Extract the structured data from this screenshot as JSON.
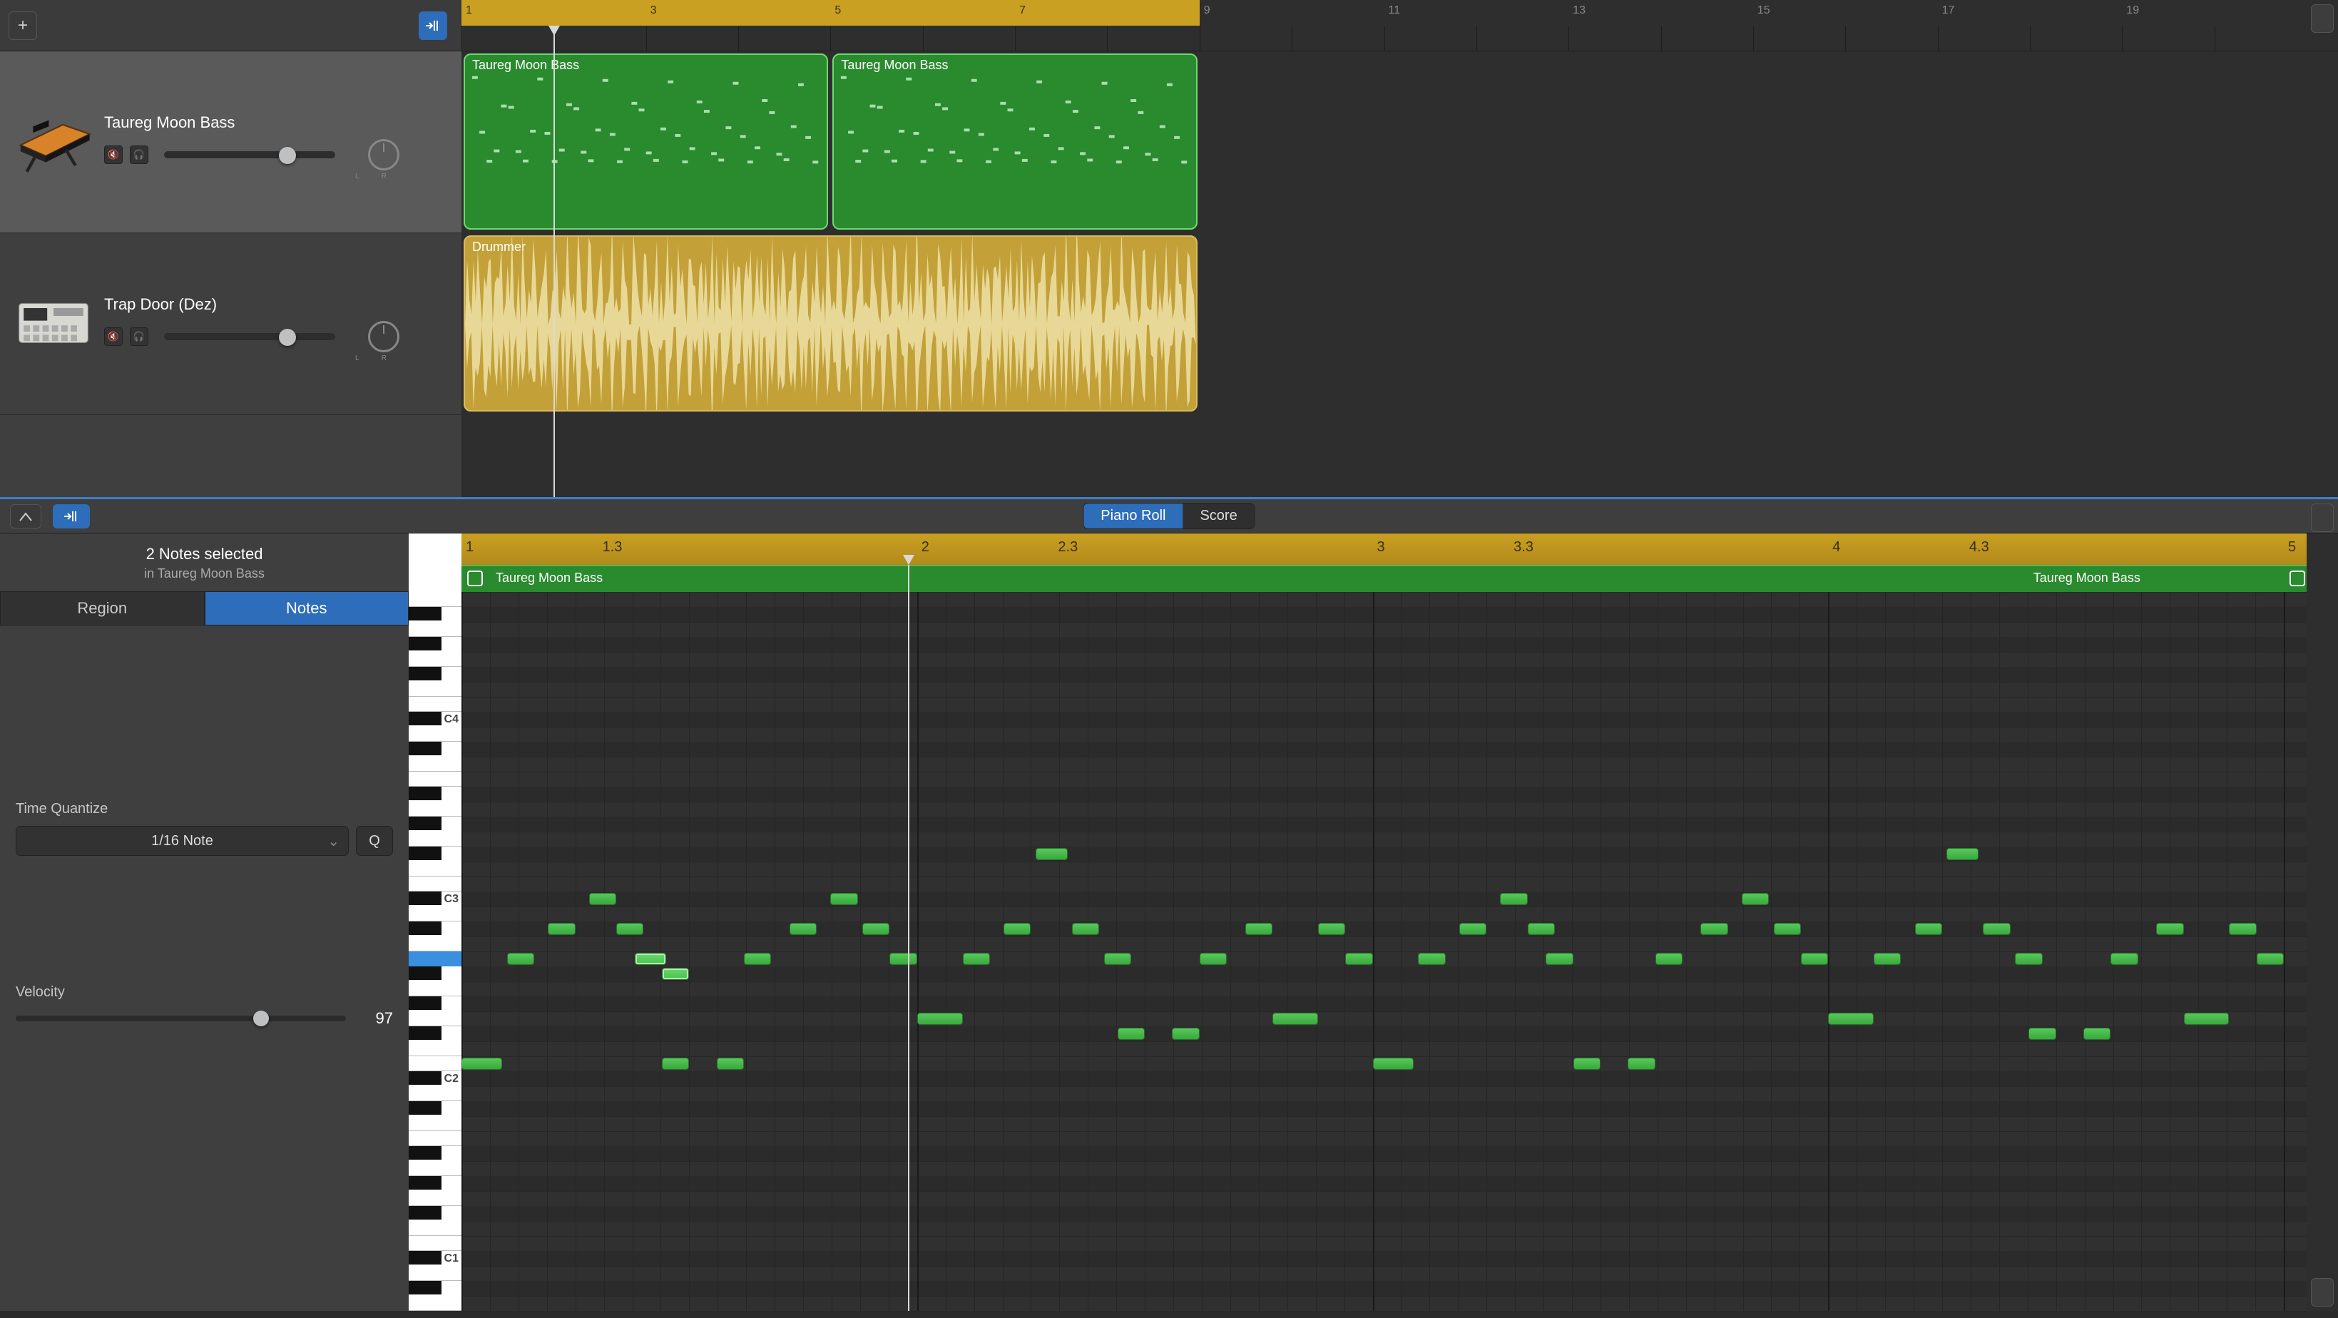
{
  "header": {
    "add_tooltip": "+"
  },
  "tracks": [
    {
      "name": "Taureg Moon Bass",
      "selected": true,
      "volume_pct": 67,
      "icon": "synth"
    },
    {
      "name": "Trap Door (Dez)",
      "selected": false,
      "volume_pct": 67,
      "icon": "drum-machine"
    }
  ],
  "arrange": {
    "ruler_labels": [
      "1",
      "3",
      "5",
      "7",
      "9",
      "11",
      "13",
      "15",
      "17",
      "19"
    ],
    "cycle_start_bar": 1,
    "cycle_end_bar": 9,
    "playhead_bar": 2.0,
    "regions": [
      {
        "bar_start": 1,
        "bar_end": 5,
        "track": 0,
        "color": "green",
        "label": "Taureg Moon Bass"
      },
      {
        "bar_start": 5,
        "bar_end": 9,
        "track": 0,
        "color": "green",
        "label": "Taureg Moon Bass"
      },
      {
        "bar_start": 1,
        "bar_end": 9,
        "track": 1,
        "color": "yellow",
        "label": "Drummer"
      }
    ]
  },
  "editor_bar": {
    "piano_roll_label": "Piano Roll",
    "score_label": "Score",
    "active_tab": "piano_roll"
  },
  "inspector": {
    "title": "2 Notes selected",
    "subtitle": "in Taureg Moon Bass",
    "tab_region": "Region",
    "tab_notes": "Notes",
    "active_tab": "Notes",
    "quantize_label": "Time Quantize",
    "quantize_value": "1/16 Note",
    "quantize_btn": "Q",
    "velocity_label": "Velocity",
    "velocity_value": "97"
  },
  "piano_roll": {
    "ruler_labels": [
      "1",
      "1.3",
      "2",
      "2.3",
      "3",
      "3.3",
      "4",
      "4.3",
      "5"
    ],
    "region_labels": [
      "Taureg Moon Bass",
      "Taureg Moon Bass"
    ],
    "playhead_pos": 1.98,
    "key_labels": [
      "C4",
      "C3",
      "C2",
      "C1"
    ],
    "selected_key_index": 23,
    "notes": [
      {
        "t": 1.0,
        "k": 16,
        "len": 0.09
      },
      {
        "t": 1.1,
        "k": 23,
        "len": 0.06
      },
      {
        "t": 1.19,
        "k": 25,
        "len": 0.06
      },
      {
        "t": 1.28,
        "k": 27,
        "len": 0.06
      },
      {
        "t": 1.34,
        "k": 25,
        "len": 0.06
      },
      {
        "t": 1.38,
        "k": 23,
        "len": 0.07,
        "sel": true
      },
      {
        "t": 1.44,
        "k": 22,
        "len": 0.06,
        "sel": true
      },
      {
        "t": 1.44,
        "k": 16,
        "len": 0.06
      },
      {
        "t": 1.56,
        "k": 16,
        "len": 0.06
      },
      {
        "t": 1.62,
        "k": 23,
        "len": 0.06
      },
      {
        "t": 1.72,
        "k": 25,
        "len": 0.06
      },
      {
        "t": 1.81,
        "k": 27,
        "len": 0.06
      },
      {
        "t": 1.88,
        "k": 25,
        "len": 0.06
      },
      {
        "t": 1.94,
        "k": 23,
        "len": 0.06
      },
      {
        "t": 2.0,
        "k": 19,
        "len": 0.1
      },
      {
        "t": 2.1,
        "k": 23,
        "len": 0.06
      },
      {
        "t": 2.19,
        "k": 25,
        "len": 0.06
      },
      {
        "t": 2.26,
        "k": 30,
        "len": 0.07
      },
      {
        "t": 2.34,
        "k": 25,
        "len": 0.06
      },
      {
        "t": 2.41,
        "k": 23,
        "len": 0.06
      },
      {
        "t": 2.44,
        "k": 18,
        "len": 0.06
      },
      {
        "t": 2.56,
        "k": 18,
        "len": 0.06
      },
      {
        "t": 2.62,
        "k": 23,
        "len": 0.06
      },
      {
        "t": 2.72,
        "k": 25,
        "len": 0.06
      },
      {
        "t": 2.78,
        "k": 19,
        "len": 0.1
      },
      {
        "t": 2.88,
        "k": 25,
        "len": 0.06
      },
      {
        "t": 2.94,
        "k": 23,
        "len": 0.06
      },
      {
        "t": 3.0,
        "k": 16,
        "len": 0.09
      },
      {
        "t": 3.1,
        "k": 23,
        "len": 0.06
      },
      {
        "t": 3.19,
        "k": 25,
        "len": 0.06
      },
      {
        "t": 3.28,
        "k": 27,
        "len": 0.06
      },
      {
        "t": 3.34,
        "k": 25,
        "len": 0.06
      },
      {
        "t": 3.38,
        "k": 23,
        "len": 0.06
      },
      {
        "t": 3.44,
        "k": 16,
        "len": 0.06
      },
      {
        "t": 3.56,
        "k": 16,
        "len": 0.06
      },
      {
        "t": 3.62,
        "k": 23,
        "len": 0.06
      },
      {
        "t": 3.72,
        "k": 25,
        "len": 0.06
      },
      {
        "t": 3.81,
        "k": 27,
        "len": 0.06
      },
      {
        "t": 3.88,
        "k": 25,
        "len": 0.06
      },
      {
        "t": 3.94,
        "k": 23,
        "len": 0.06
      },
      {
        "t": 4.0,
        "k": 19,
        "len": 0.1
      },
      {
        "t": 4.1,
        "k": 23,
        "len": 0.06
      },
      {
        "t": 4.19,
        "k": 25,
        "len": 0.06
      },
      {
        "t": 4.26,
        "k": 30,
        "len": 0.07
      },
      {
        "t": 4.34,
        "k": 25,
        "len": 0.06
      },
      {
        "t": 4.41,
        "k": 23,
        "len": 0.06
      },
      {
        "t": 4.44,
        "k": 18,
        "len": 0.06
      },
      {
        "t": 4.56,
        "k": 18,
        "len": 0.06
      },
      {
        "t": 4.62,
        "k": 23,
        "len": 0.06
      },
      {
        "t": 4.72,
        "k": 25,
        "len": 0.06
      },
      {
        "t": 4.78,
        "k": 19,
        "len": 0.1
      },
      {
        "t": 4.88,
        "k": 25,
        "len": 0.06
      },
      {
        "t": 4.94,
        "k": 23,
        "len": 0.06
      }
    ]
  },
  "colors": {
    "region_green": "#2a8a2e",
    "region_yellow": "#c3a138",
    "accent_blue": "#2d6db9",
    "ruler_gold": "#c9a021"
  }
}
